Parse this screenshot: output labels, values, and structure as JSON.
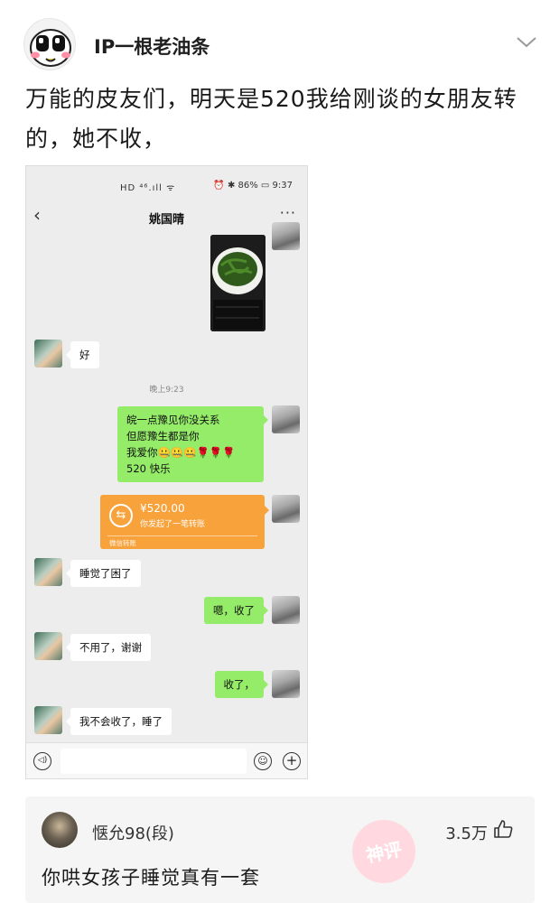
{
  "post": {
    "author": "IP一根老油条",
    "text": "万能的皮友们，明天是520我给刚谈的女朋友转的，她不收，"
  },
  "screenshot": {
    "status_left": "HD ⁴⁶.ıll ᯤ",
    "status_right": "⏰ ✱ 86% ▭ 9:37",
    "back_glyph": "‹",
    "contact_name": "姚国晴",
    "more_glyph": "···",
    "timestamp": "晚上9:23",
    "messages": {
      "hao": "好",
      "poem_l1": "皖一点豫见你没关系",
      "poem_l2": "但愿豫生都是你",
      "poem_l3": "我爱你🤐🤐🤐🌹🌹🌹",
      "poem_l4": "520 快乐",
      "sleepy": "睡觉了困了",
      "received": "嗯，收了",
      "no_need": "不用了，谢谢",
      "received2": "收了，",
      "wont_take": "我不会收了，睡了"
    },
    "transfer": {
      "icon": "⇆",
      "amount": "¥520.00",
      "desc": "你发起了一笔转账",
      "footer": "微信转账"
    },
    "input": {
      "voice_glyph": "◁)",
      "emoji_glyph": "☺",
      "plus_glyph": "+"
    }
  },
  "comment": {
    "username": "惬允98(段)",
    "likes": "3.5万",
    "text": "你哄女孩子睡觉真有一套",
    "stamp": "神评"
  }
}
